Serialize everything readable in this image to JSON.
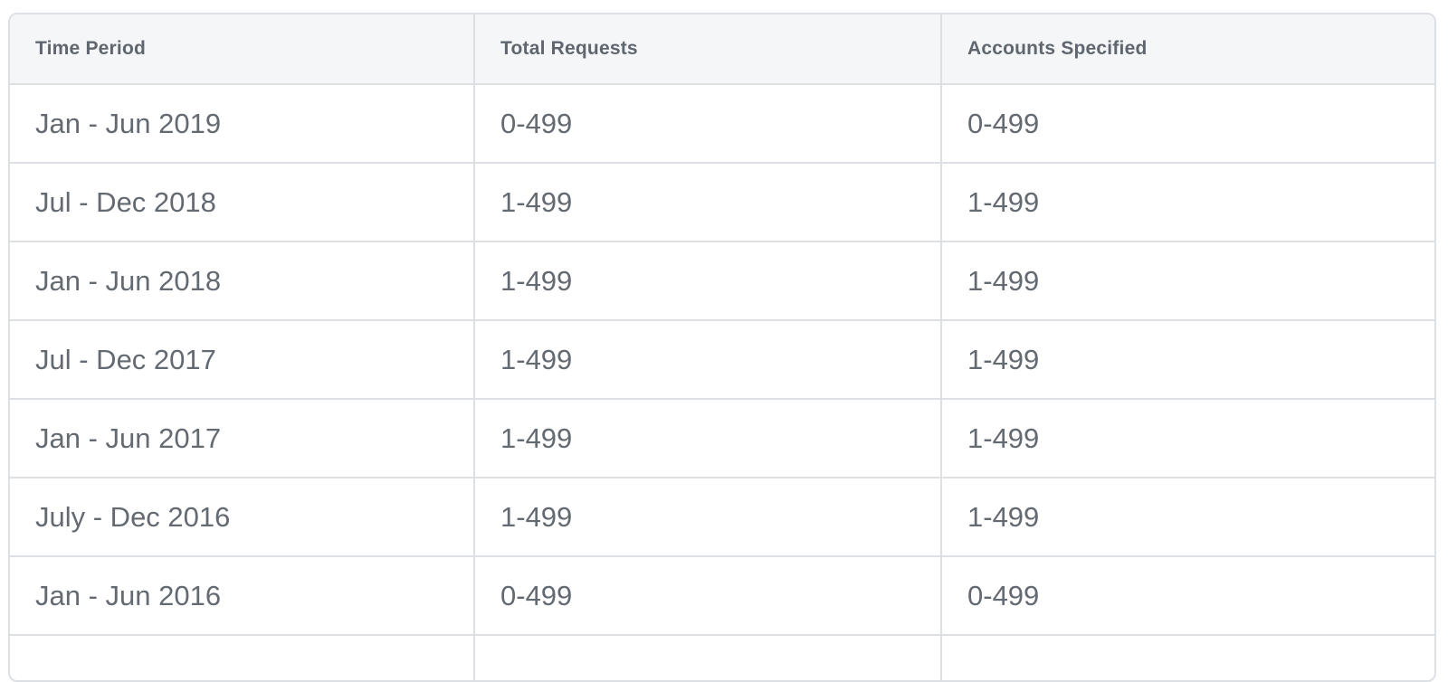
{
  "table": {
    "headers": [
      "Time Period",
      "Total Requests",
      "Accounts Specified"
    ],
    "rows": [
      [
        "Jan - Jun 2019",
        "0-499",
        "0-499"
      ],
      [
        "Jul - Dec 2018",
        "1-499",
        "1-499"
      ],
      [
        "Jan - Jun 2018",
        "1-499",
        "1-499"
      ],
      [
        "Jul - Dec 2017",
        "1-499",
        "1-499"
      ],
      [
        "Jan - Jun 2017",
        "1-499",
        "1-499"
      ],
      [
        "July - Dec 2016",
        "1-499",
        "1-499"
      ],
      [
        "Jan - Jun 2016",
        "0-499",
        "0-499"
      ],
      [
        "",
        "",
        ""
      ]
    ]
  },
  "colors": {
    "header_bg": "#f5f6f7",
    "border": "#dcdfe3",
    "header_text": "#5f6670",
    "cell_text": "#646a72"
  }
}
